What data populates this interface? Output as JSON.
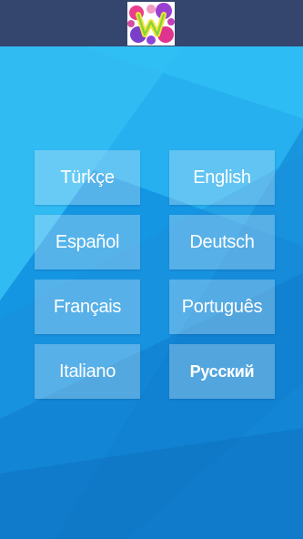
{
  "header": {
    "logo_icon": "colorful-w-logo-icon",
    "background_color": "#34466d"
  },
  "languages": [
    {
      "label": "Türkçe"
    },
    {
      "label": "English"
    },
    {
      "label": "Español"
    },
    {
      "label": "Deutsch"
    },
    {
      "label": "Français"
    },
    {
      "label": "Português"
    },
    {
      "label": "Italiano"
    },
    {
      "label": "Русский",
      "selected": true
    }
  ],
  "colors": {
    "background_main": "#1596e2",
    "button_fill": "rgba(210,235,250,0.34)",
    "button_text": "#ffffff"
  }
}
